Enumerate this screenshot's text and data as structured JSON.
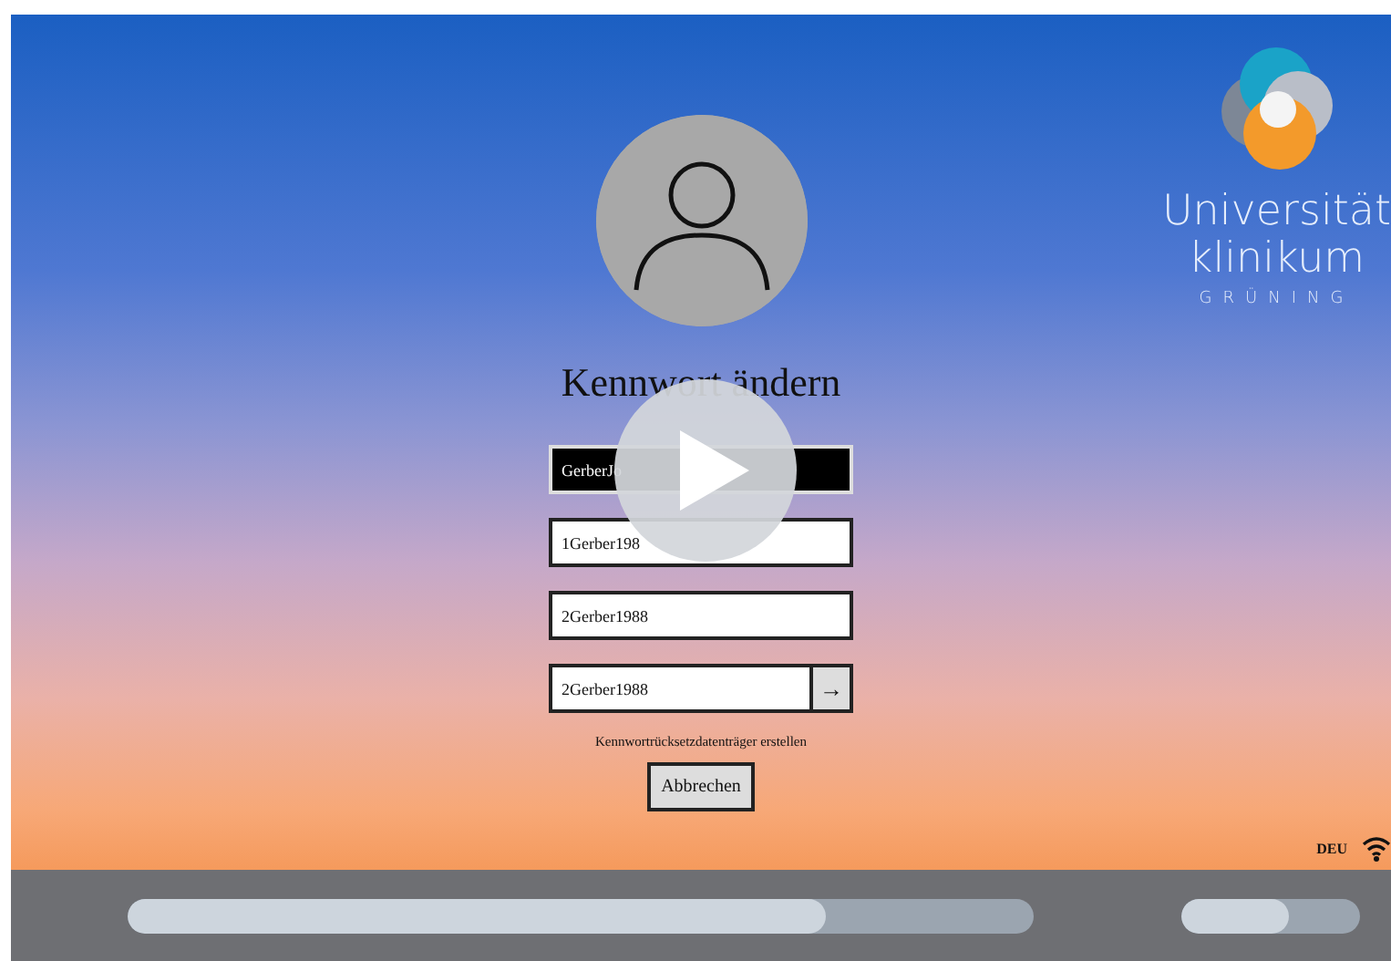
{
  "login": {
    "title": "Kennwort ändern",
    "fields": [
      {
        "value": "GerberJo",
        "highlighted": true
      },
      {
        "value": "1Gerber198",
        "highlighted": false
      },
      {
        "value": "2Gerber1988",
        "highlighted": false
      },
      {
        "value": "2Gerber1988",
        "highlighted": false,
        "submit": "→"
      }
    ],
    "reset_link": "Kennwortrücksetzdatenträger erstellen",
    "cancel_button": "Abbrechen"
  },
  "logo": {
    "line1": "Universität",
    "line2": "klinikum",
    "line3": "GRÜNING"
  },
  "tray": {
    "language": "DEU"
  },
  "player": {
    "seek": {
      "level": 0.77
    },
    "volume": {
      "level": 0.6
    }
  }
}
